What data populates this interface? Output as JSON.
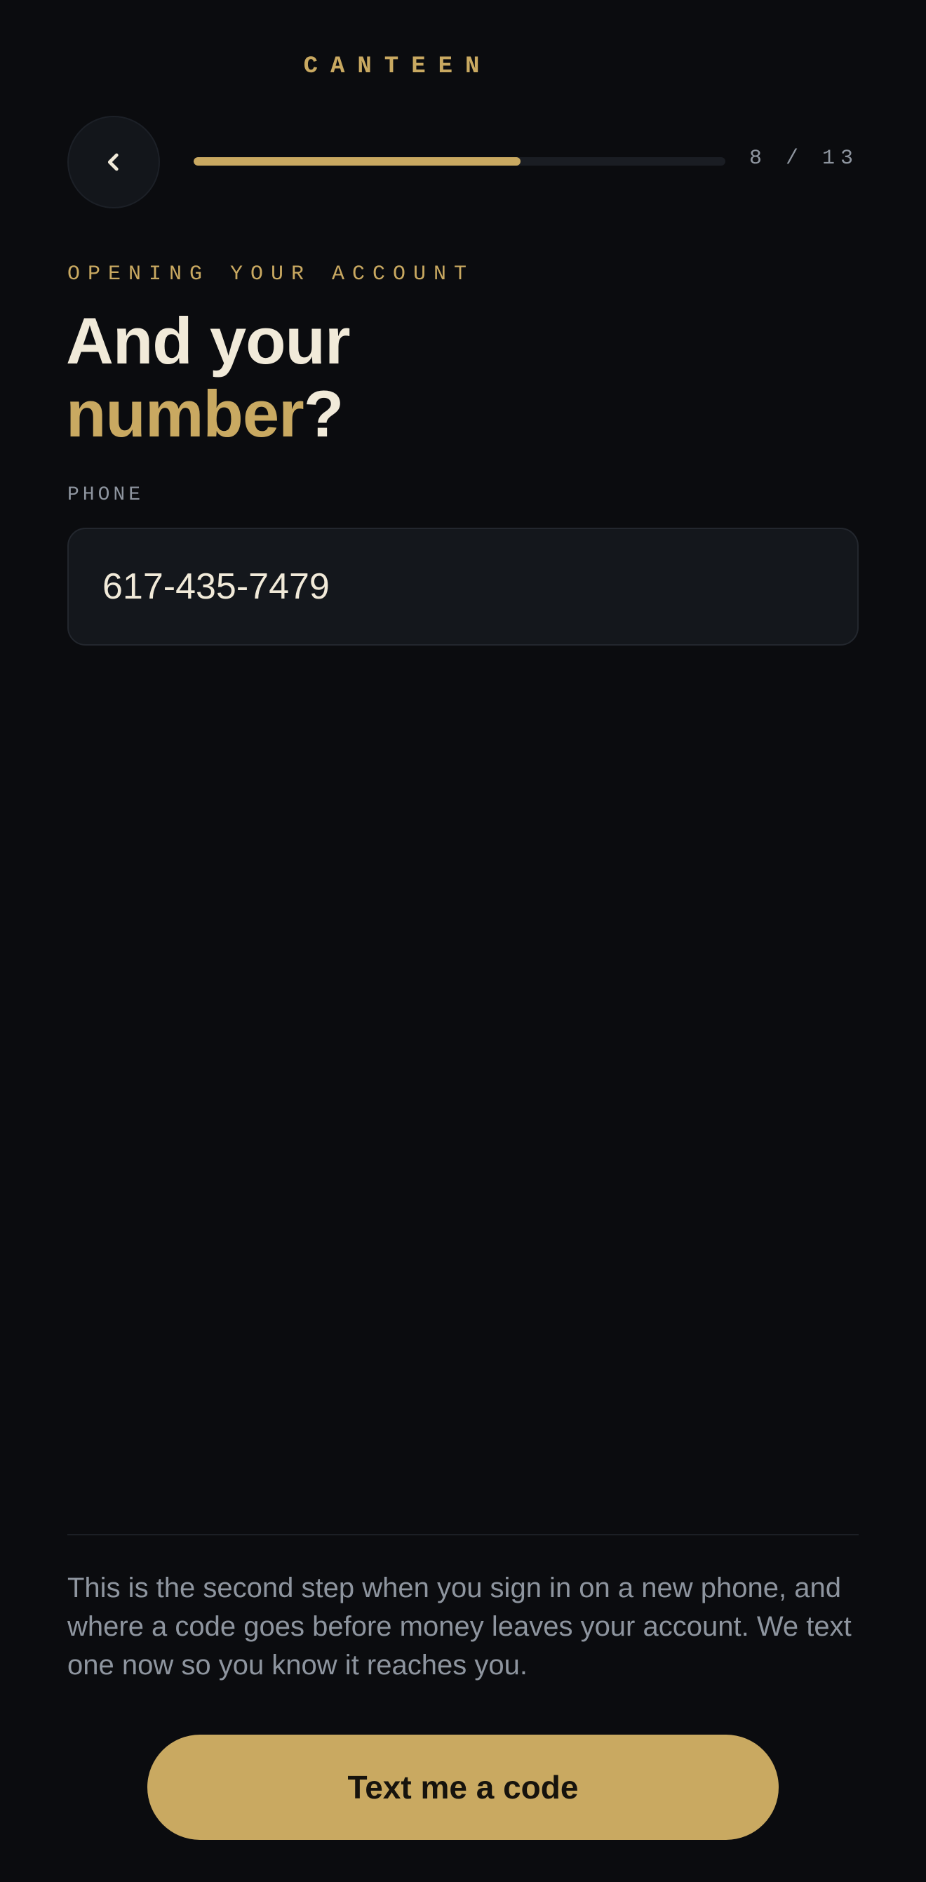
{
  "app": {
    "brand": "CANTEEN"
  },
  "header": {
    "back_icon": "chevron-left-icon",
    "progress_fraction": 0.615,
    "step_counter": "8 / 13"
  },
  "main": {
    "eyebrow": "OPENING YOUR ACCOUNT",
    "headline_line1": "And your",
    "headline_accent": "number",
    "headline_suffix": "?",
    "phone": {
      "label": "PHONE",
      "value": "617-435-7479"
    }
  },
  "footer": {
    "info": "This is the second step when you sign in on a new phone, and where a code goes before money leaves your account. We text one now so you know it reaches you.",
    "cta_label": "Text me a code"
  },
  "colors": {
    "background": "#0b0c0f",
    "accent": "#c9a961",
    "text_primary": "#f1ead9",
    "text_muted": "#8e959f"
  }
}
